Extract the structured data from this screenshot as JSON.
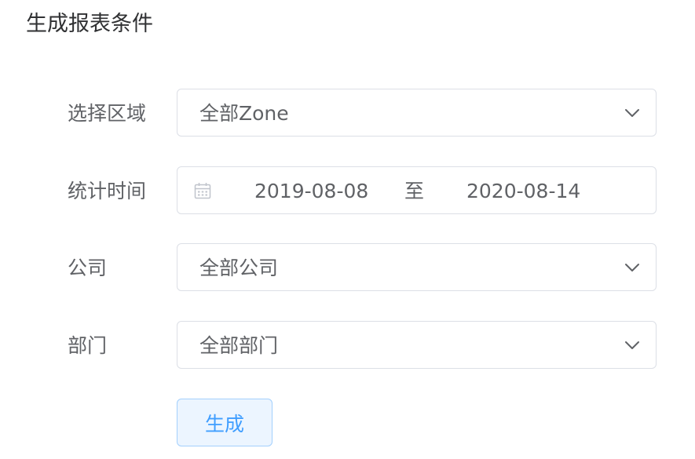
{
  "page": {
    "title": "生成报表条件"
  },
  "form": {
    "region": {
      "label": "选择区域",
      "value": "全部Zone"
    },
    "stat_time": {
      "label": "统计时间",
      "start": "2019-08-08",
      "separator": "至",
      "end": "2020-08-14"
    },
    "company": {
      "label": "公司",
      "value": "全部公司"
    },
    "department": {
      "label": "部门",
      "value": "全部部门"
    },
    "submit_label": "生成"
  },
  "icons": {
    "dropdown": "chevron-down-icon",
    "date": "calendar-icon"
  },
  "colors": {
    "primary": "#409eff",
    "primary_light_bg": "#ecf5ff",
    "border": "#dcdfe6",
    "text": "#606266",
    "title": "#303133"
  }
}
